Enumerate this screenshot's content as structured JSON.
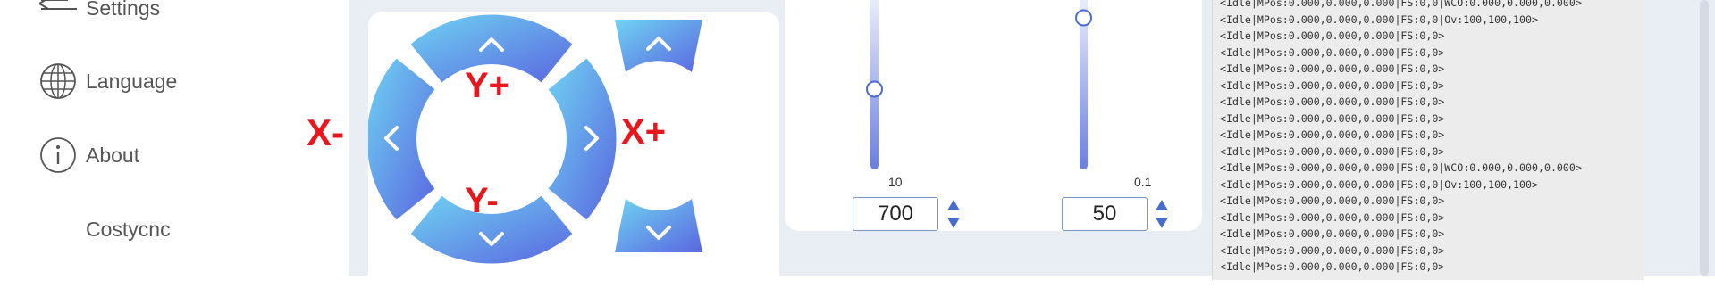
{
  "sidebar": {
    "items": [
      {
        "label": "Settings",
        "icon": "settings-lines-icon"
      },
      {
        "label": "Language",
        "icon": "globe-icon"
      },
      {
        "label": "About",
        "icon": "info-icon"
      },
      {
        "label": "Costycnc",
        "icon": ""
      }
    ]
  },
  "jog": {
    "x_minus": "X-",
    "x_plus": "X+",
    "y_plus": "Y+",
    "y_minus": "Y-"
  },
  "sliders": {
    "feed": {
      "min_label": "10",
      "value": "700",
      "level": 0.45
    },
    "step": {
      "min_label": "0.1",
      "value": "50",
      "level": 0.85
    }
  },
  "console": {
    "lines": [
      "<Idle|MPos:0.000,0.000,0.000|FS:0,0|WCO:0.000,0.000,0.000>",
      "<Idle|MPos:0.000,0.000,0.000|FS:0,0|Ov:100,100,100>",
      "<Idle|MPos:0.000,0.000,0.000|FS:0,0>",
      "<Idle|MPos:0.000,0.000,0.000|FS:0,0>",
      "<Idle|MPos:0.000,0.000,0.000|FS:0,0>",
      "<Idle|MPos:0.000,0.000,0.000|FS:0,0>",
      "<Idle|MPos:0.000,0.000,0.000|FS:0,0>",
      "<Idle|MPos:0.000,0.000,0.000|FS:0,0>",
      "<Idle|MPos:0.000,0.000,0.000|FS:0,0>",
      "<Idle|MPos:0.000,0.000,0.000|FS:0,0>",
      "<Idle|MPos:0.000,0.000,0.000|FS:0,0|WCO:0.000,0.000,0.000>",
      "<Idle|MPos:0.000,0.000,0.000|FS:0,0|Ov:100,100,100>",
      "<Idle|MPos:0.000,0.000,0.000|FS:0,0>",
      "<Idle|MPos:0.000,0.000,0.000|FS:0,0>",
      "<Idle|MPos:0.000,0.000,0.000|FS:0,0>",
      "<Idle|MPos:0.000,0.000,0.000|FS:0,0>",
      "<Idle|MPos:0.000,0.000,0.000|FS:0,0>"
    ]
  },
  "colors": {
    "accent": "#e8161d",
    "gradient_start": "#6fd3f2",
    "gradient_end": "#5a66e0",
    "main_bg": "#e9edf4"
  }
}
